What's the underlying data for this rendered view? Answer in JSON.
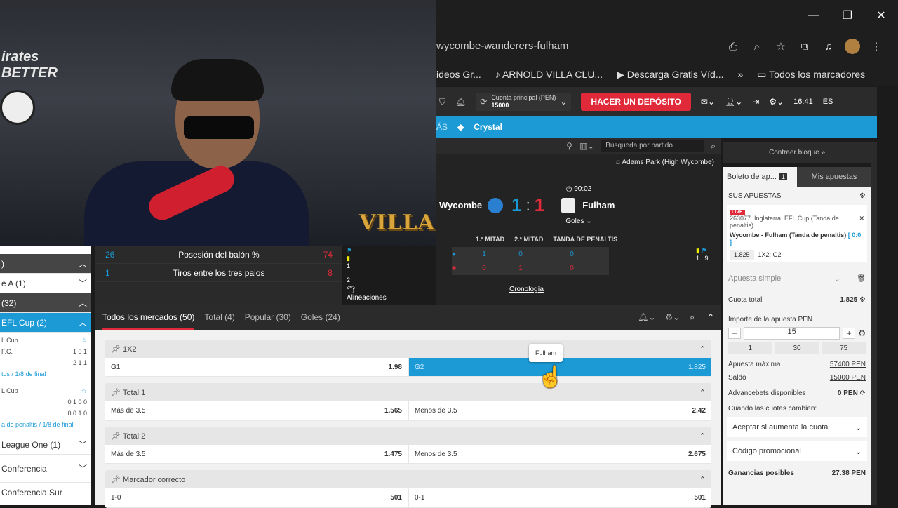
{
  "browser": {
    "address": "wycombe-wanderers-fulham",
    "bookmarks": [
      "ideos Gr...",
      "ARNOLD VILLA CLU...",
      "Descarga Gratis Víd..."
    ],
    "bookmarks_folder": "Todos los marcadores"
  },
  "webcam": {
    "overlay_logo": "VILLA",
    "wall_text": "irates\nBETTER"
  },
  "header": {
    "account_label": "Cuenta principal (PEN)",
    "account_balance": "15000",
    "deposit_button": "HACER UN DEPÓSITO",
    "time": "16:41",
    "language": "ES"
  },
  "nav": {
    "more": "ÁS",
    "item": "Crystal"
  },
  "match_toolbar": {
    "search_placeholder": "Búsqueda por partido"
  },
  "match": {
    "venue": "Adams Park (High Wycombe)",
    "home": "Wycombe",
    "away": "Fulham",
    "home_score": "1",
    "sep": ":",
    "away_score": "1",
    "clock": "90:02",
    "goals_dropdown": "Goles",
    "col1": "1.ª MITAD",
    "col2": "2.ª MITAD",
    "col3": "TANDA DE PENALTIS",
    "home_row": [
      "1",
      "0",
      "0"
    ],
    "away_row": [
      "0",
      "1",
      "0"
    ],
    "home_cards": [
      "1",
      "2"
    ],
    "away_cards": [
      "1",
      "9"
    ],
    "lineups": "Alineaciones",
    "timeline": "Cronología"
  },
  "stats": [
    {
      "home": "26",
      "label": "Posesión del balón %",
      "away": "74"
    },
    {
      "home": "1",
      "label": "Tiros entre los tres palos",
      "away": "8"
    }
  ],
  "sidebar": {
    "rows": [
      {
        "text": ")",
        "style": "dark"
      },
      {
        "text": "e A (1)",
        "style": "plain"
      },
      {
        "text": "(32)",
        "style": "dark"
      },
      {
        "text": "EFL Cup (2)",
        "style": "blue"
      }
    ],
    "m1_league": "L Cup",
    "m1_team1": "F.C.",
    "m1_score1": "1 0 1",
    "m1_score2": "2 1 1",
    "m1_link": "tos / 1/8 de final",
    "m2_league": "L Cup",
    "m2_score1": "0 1 0 0",
    "m2_score2": "0 0 1 0",
    "m2_link": "a de penaltis / 1/8 de final",
    "league_one": "League One (1)",
    "conf": "Conferencia",
    "conf_sur": "Conferencia Sur"
  },
  "markets_tabs": [
    "Todos los mercados (50)",
    "Total (4)",
    "Popular (30)",
    "Goles (24)"
  ],
  "markets": [
    {
      "title": "1X2",
      "cells": [
        [
          "G1",
          "1.98"
        ],
        [
          "G2",
          "1.825"
        ]
      ]
    },
    {
      "title": "Total 1",
      "cells": [
        [
          "Más de 3.5",
          "1.565"
        ],
        [
          "Menos de 3.5",
          "2.42"
        ]
      ]
    },
    {
      "title": "Total 2",
      "cells": [
        [
          "Más de 3.5",
          "1.475"
        ],
        [
          "Menos de 3.5",
          "2.675"
        ]
      ]
    },
    {
      "title": "Marcador correcto",
      "cells": [
        [
          "1-0",
          "501"
        ],
        [
          "0-1",
          "501"
        ]
      ]
    }
  ],
  "tooltip": "Fulham",
  "betslip": {
    "contraer": "Contraer bloque »",
    "tab_slip": "Boleto de ap...",
    "tab_count": "1",
    "tab_my": "Mis apuestas",
    "sus": "SUS APUESTAS",
    "live": "LIVE",
    "event": "263077. Inglaterra. EFL Cup (Tanda de penaltis)",
    "match": "Wycombe - Fulham (Tanda de penaltis)",
    "score": "[ 0:0 ]",
    "odd": "1.825",
    "pick": "1X2: G2",
    "bet_type": "Apuesta simple",
    "cuota_label": "Cuota total",
    "cuota": "1.825",
    "importe_label": "Importe de la apuesta PEN",
    "amount": "15",
    "quick": [
      "1",
      "30",
      "75"
    ],
    "max_label": "Apuesta máxima",
    "max": "57400 PEN",
    "saldo_label": "Saldo",
    "saldo": "15000 PEN",
    "adv_label": "Advancebets disponibles",
    "adv": "0 PEN",
    "cambian": "Cuando las cuotas cambien:",
    "accept": "Aceptar si aumenta la cuota",
    "promo": "Código promocional",
    "gan_label": "Ganancias posibles",
    "gan": "27.38 PEN"
  },
  "colors": {
    "accent": "#1b9ad6",
    "deposit": "#e02a3a"
  }
}
